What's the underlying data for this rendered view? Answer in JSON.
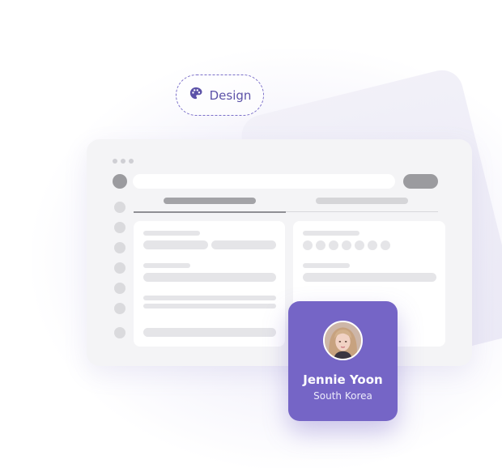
{
  "design_chip": {
    "label": "Design",
    "icon": "palette-icon",
    "accent": "#7b6fc9"
  },
  "window": {
    "tabs": [
      {
        "name": "tab-1",
        "active": true
      },
      {
        "name": "tab-2",
        "active": false
      }
    ]
  },
  "profile_card": {
    "name": "Jennie Yoon",
    "country": "South Korea",
    "background": "#7565c6"
  }
}
